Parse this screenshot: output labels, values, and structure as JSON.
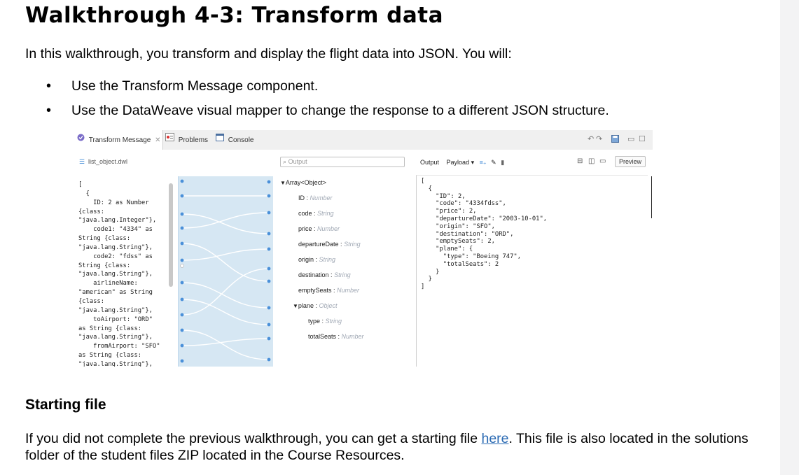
{
  "page": {
    "title": "Walkthrough 4-3: Transform data",
    "intro": "In this walkthrough, you transform and display the flight data into JSON. You will:",
    "bullets": [
      "Use the Transform Message component.",
      "Use the DataWeave visual mapper to change the response to a different JSON structure."
    ],
    "section_title": "Starting file",
    "outro_before": "If you did not complete the previous walkthrough, you can get a starting file ",
    "outro_link": "here",
    "outro_after": ". This file is also located in the solutions folder of the student files ZIP located in the Course Resources."
  },
  "ide": {
    "tabs": {
      "transform": "Transform Message",
      "problems": "Problems",
      "console": "Console"
    },
    "left_file": "list_object.dwl",
    "left_code": "[\n  {\n    ID: 2 as Number\n{class:\n\"java.lang.Integer\"},\n    code1: \"4334\" as\nString {class:\n\"java.lang.String\"},\n    code2: \"fdss\" as\nString {class:\n\"java.lang.String\"},\n    airlineName:\n\"american\" as String\n{class:\n\"java.lang.String\"},\n    toAirport: \"ORD\"\nas String {class:\n\"java.lang.String\"},\n    fromAirport: \"SFO\"\nas String {class:\n\"java.lang.String\"},",
    "search_placeholder": "Output",
    "tree": {
      "root": "Array<Object>",
      "fields": [
        {
          "name": "ID",
          "type": "Number"
        },
        {
          "name": "code",
          "type": "String"
        },
        {
          "name": "price",
          "type": "Number"
        },
        {
          "name": "departureDate",
          "type": "String"
        },
        {
          "name": "origin",
          "type": "String"
        },
        {
          "name": "destination",
          "type": "String"
        },
        {
          "name": "emptySeats",
          "type": "Number"
        },
        {
          "name": "plane",
          "type": "Object"
        }
      ],
      "children": [
        {
          "name": "type",
          "type": "String"
        },
        {
          "name": "totalSeats",
          "type": "Number"
        }
      ]
    },
    "output_label": "Output",
    "payload_label": "Payload",
    "preview_label": "Preview",
    "output_json": "[\n  {\n    \"ID\": 2,\n    \"code\": \"4334fdss\",\n    \"price\": 2,\n    \"departureDate\": \"2003-10-01\",\n    \"origin\": \"SFO\",\n    \"destination\": \"ORD\",\n    \"emptySeats\": 2,\n    \"plane\": {\n      \"type\": \"Boeing 747\",\n      \"totalSeats\": 2\n    }\n  }\n]",
    "colors": {
      "mapping_band": "#d6e7f3",
      "connector": "#4a90d9",
      "link": "#2a6ab3"
    }
  }
}
